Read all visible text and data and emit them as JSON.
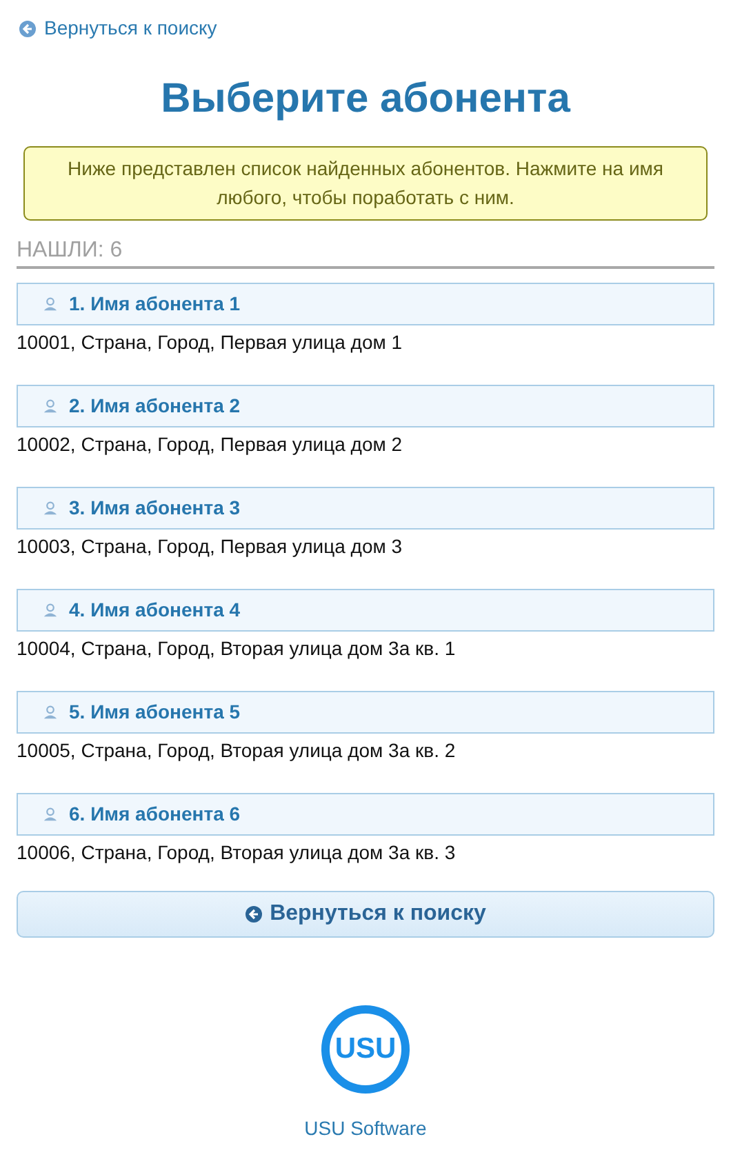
{
  "back_link": "Вернуться к поиску",
  "title": "Выберите абонента",
  "notice": "Ниже представлен список найденных абонентов. Нажмите на имя любого, чтобы поработать с ним.",
  "found": "НАШЛИ: 6",
  "subscribers": [
    {
      "name": "1. Имя абонента 1",
      "address": "10001, Страна, Город, Первая улица дом 1"
    },
    {
      "name": "2. Имя абонента 2",
      "address": "10002, Страна, Город, Первая улица дом 2"
    },
    {
      "name": "3. Имя абонента 3",
      "address": "10003, Страна, Город, Первая улица дом 3"
    },
    {
      "name": "4. Имя абонента 4",
      "address": "10004, Страна, Город, Вторая улица дом 3а кв. 1"
    },
    {
      "name": "5. Имя абонента 5",
      "address": "10005, Страна, Город, Вторая улица дом 3а кв. 2"
    },
    {
      "name": "6. Имя абонента 6",
      "address": "10006, Страна, Город, Вторая улица дом 3а кв. 3"
    }
  ],
  "back_button": "Вернуться к поиску",
  "footer": {
    "logo_text": "USU",
    "caption": "USU Software"
  }
}
